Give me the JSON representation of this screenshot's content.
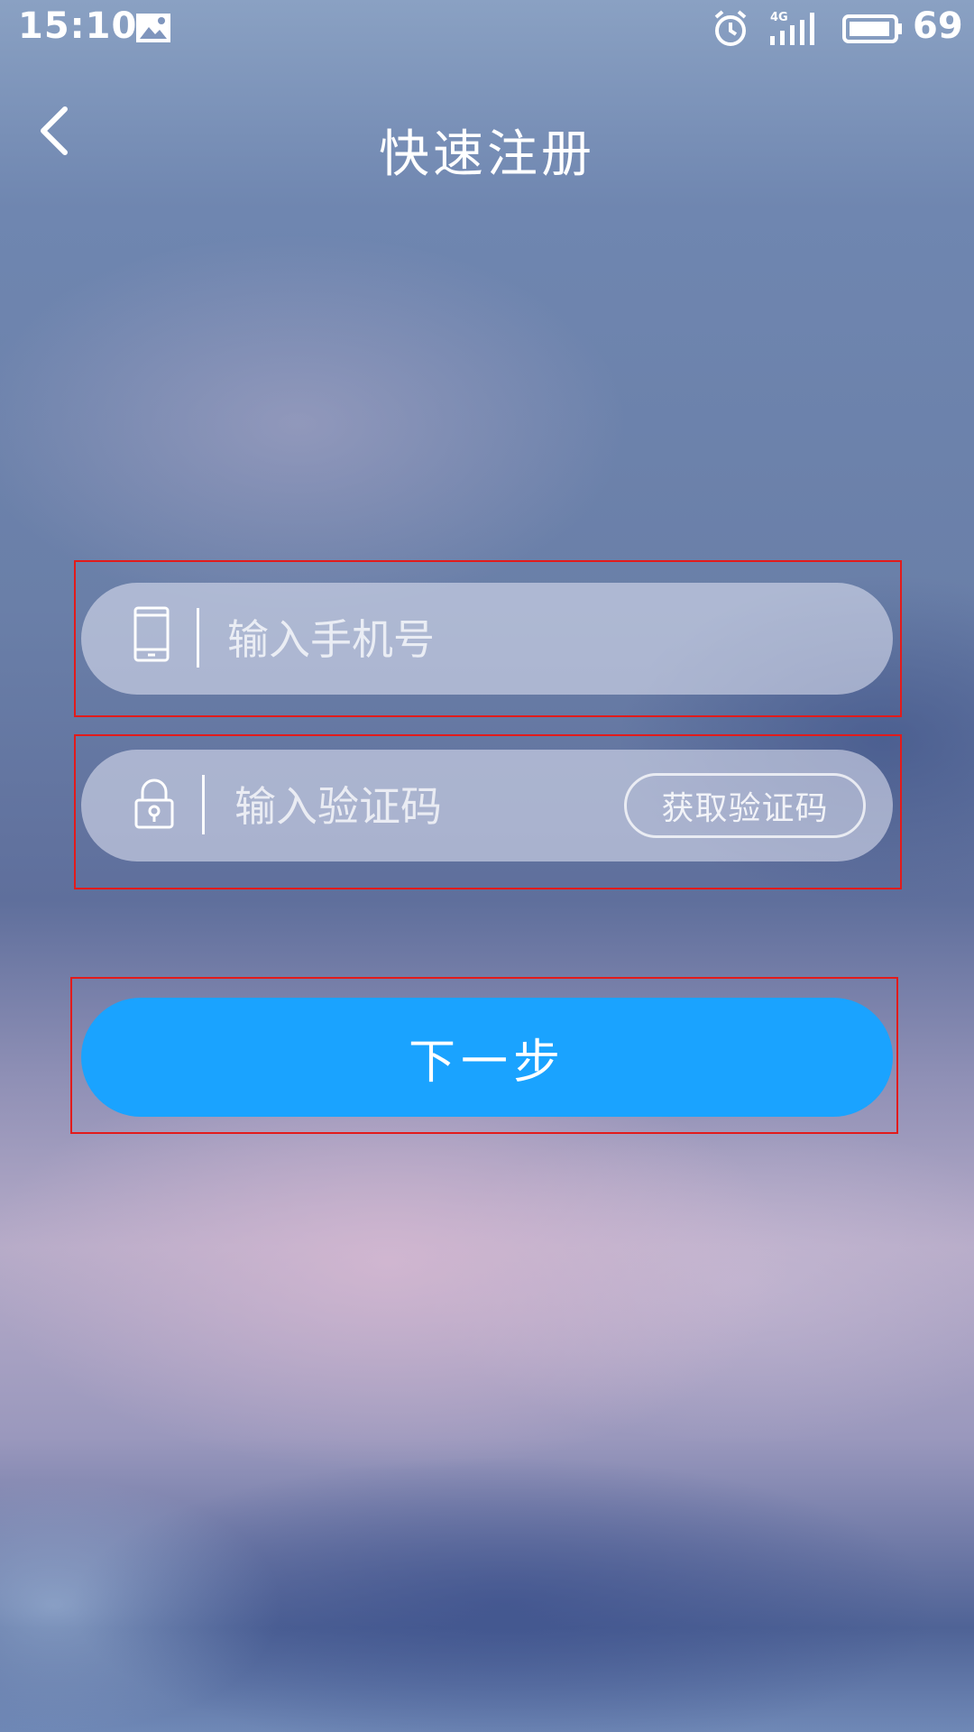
{
  "status_bar": {
    "time": "15:10",
    "network": "4G",
    "battery": "69",
    "icons": [
      "image-icon",
      "alarm-icon",
      "signal-icon",
      "battery-icon"
    ]
  },
  "header": {
    "title": "快速注册",
    "back_icon": "chevron-left-icon"
  },
  "form": {
    "phone_placeholder": "输入手机号",
    "phone_icon": "phone-icon",
    "code_placeholder": "输入验证码",
    "code_icon": "lock-icon",
    "get_code_label": "获取验证码"
  },
  "actions": {
    "next_label": "下一步"
  },
  "colors": {
    "accent": "#1aa3ff",
    "highlight_outline": "#e21b1b"
  }
}
